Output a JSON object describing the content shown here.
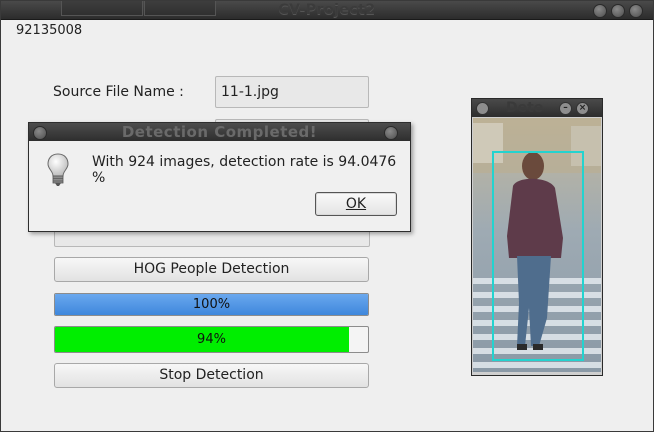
{
  "window": {
    "title": "CV-Project2"
  },
  "id_text": "92135008",
  "form": {
    "source_label": "Source File Name :",
    "source_value": "11-1.jpg",
    "hog_button": "HOG People Detection",
    "progress_1": {
      "value": 100,
      "text": "100%",
      "color": "#3e87dc"
    },
    "progress_2": {
      "value": 94,
      "text": "94%",
      "color": "#00ee00"
    },
    "stop_button": "Stop Detection"
  },
  "dialog": {
    "title": "Detection Completed!",
    "message": "With 924 images, detection rate is 94.0476 %",
    "ok_label": "OK",
    "icon": "lightbulb-icon"
  },
  "image_window": {
    "title": "Dete",
    "box_color": "#23d3cf"
  }
}
